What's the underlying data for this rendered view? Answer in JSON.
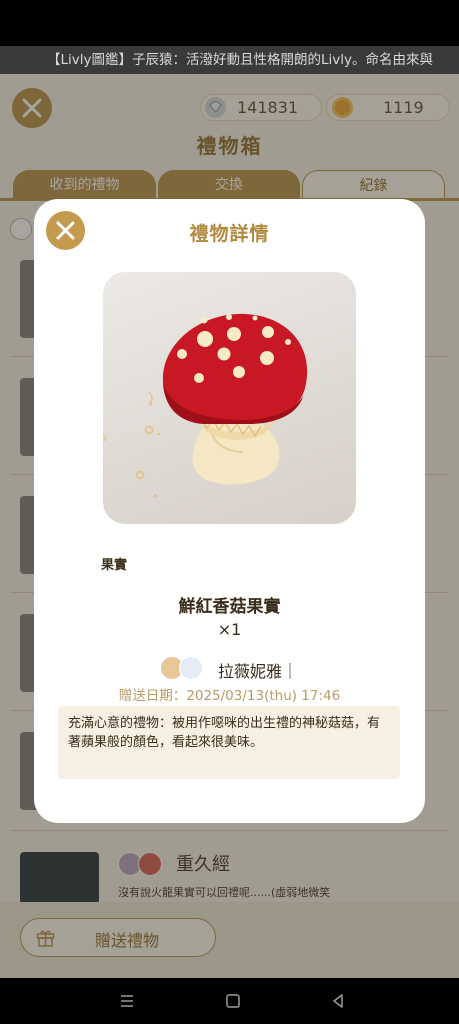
{
  "ticker": {
    "text": "【Livly圖鑑】子辰猿：活潑好動且性格開朗的Livly。命名由來與"
  },
  "app": {
    "title": "禮物箱",
    "currency": {
      "gems": "141831",
      "coins": "1119"
    },
    "tabs": [
      {
        "label": "收到的禮物"
      },
      {
        "label": "交換"
      },
      {
        "label": "紀錄"
      }
    ],
    "bottom_item": {
      "name": "重久經",
      "message": "沒有說火龍果實可以回禮呢......(虛弱地微笑"
    },
    "send_button": {
      "label": "贈送禮物"
    }
  },
  "modal": {
    "title": "禮物詳情",
    "category": "果實",
    "item_name": "鮮紅香菇果實",
    "quantity": "×1",
    "sender": "拉薇妮雅｜",
    "send_date": "贈送日期：2025/03/13(thu) 17:46",
    "description": "充滿心意的禮物：被用作噁咪的出生禮的神秘菇菇，有著蘋果般的顏色，看起來很美味。"
  },
  "colors": {
    "gold": "#b38f48",
    "modal_title": "#b28a40",
    "mushroom_cap": "#c81823",
    "date_text": "#b99a64",
    "description_bg": "#f7efe1"
  },
  "icons": [
    "close-icon",
    "diamond-icon",
    "coin-icon",
    "gift-icon",
    "menu-icon",
    "home-icon",
    "back-icon"
  ]
}
